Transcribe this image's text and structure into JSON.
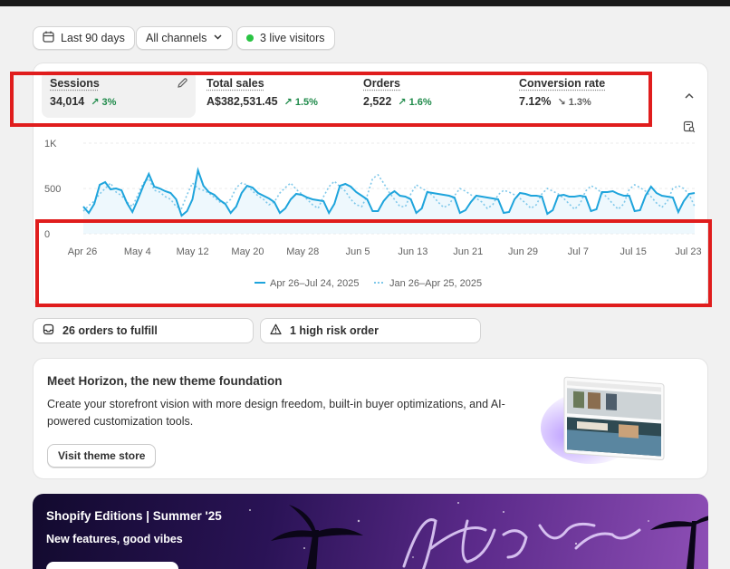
{
  "filters": {
    "date_range": "Last 90 days",
    "channels": "All channels",
    "live_visitors": "3 live visitors",
    "live_color": "#29c443"
  },
  "metrics": [
    {
      "label": "Sessions",
      "value": "34,014",
      "delta": "3%",
      "direction": "up"
    },
    {
      "label": "Total sales",
      "value": "A$382,531.45",
      "delta": "1.5%",
      "direction": "up"
    },
    {
      "label": "Orders",
      "value": "2,522",
      "delta": "1.6%",
      "direction": "up"
    },
    {
      "label": "Conversion rate",
      "value": "7.12%",
      "delta": "1.3%",
      "direction": "down"
    }
  ],
  "metric_icons": {
    "edit": "pencil-icon",
    "collapse": "chevron-up-icon",
    "report": "report-search-icon"
  },
  "chart_data": {
    "type": "line",
    "yticks": [
      "1K",
      "500",
      "0"
    ],
    "ylim": [
      0,
      1000
    ],
    "xticks": [
      "Apr 26",
      "May 4",
      "May 12",
      "May 20",
      "May 28",
      "Jun 5",
      "Jun 13",
      "Jun 21",
      "Jun 29",
      "Jul 7",
      "Jul 15",
      "Jul 23"
    ],
    "series": [
      {
        "name": "Apr 26–Jul 24, 2025",
        "style": "solid",
        "color": "#1ea4dc",
        "values": [
          300,
          230,
          330,
          540,
          570,
          490,
          500,
          480,
          340,
          240,
          380,
          530,
          660,
          520,
          500,
          470,
          450,
          380,
          200,
          250,
          380,
          700,
          530,
          460,
          430,
          370,
          330,
          230,
          300,
          450,
          530,
          510,
          450,
          420,
          390,
          350,
          230,
          280,
          380,
          440,
          430,
          400,
          380,
          370,
          360,
          230,
          330,
          530,
          550,
          520,
          460,
          420,
          380,
          250,
          250,
          360,
          430,
          470,
          420,
          410,
          380,
          230,
          280,
          460,
          450,
          440,
          430,
          420,
          400,
          230,
          260,
          350,
          420,
          410,
          400,
          390,
          380,
          230,
          240,
          380,
          450,
          440,
          420,
          420,
          410,
          220,
          260,
          420,
          430,
          410,
          410,
          420,
          410,
          250,
          270,
          460,
          460,
          470,
          440,
          420,
          420,
          250,
          260,
          420,
          520,
          450,
          420,
          410,
          400,
          240,
          360,
          440,
          450
        ]
      },
      {
        "name": "Jan 26–Apr 25, 2025",
        "style": "dotted",
        "color": "#7fc8ea",
        "values": [
          250,
          310,
          360,
          440,
          500,
          560,
          460,
          420,
          350,
          300,
          430,
          560,
          610,
          480,
          460,
          410,
          380,
          300,
          280,
          430,
          560,
          500,
          480,
          450,
          400,
          350,
          330,
          380,
          510,
          560,
          540,
          470,
          420,
          380,
          320,
          350,
          450,
          510,
          560,
          490,
          440,
          380,
          320,
          280,
          410,
          520,
          580,
          520,
          470,
          380,
          320,
          300,
          420,
          610,
          650,
          560,
          460,
          380,
          300,
          300,
          440,
          540,
          500,
          470,
          420,
          350,
          290,
          320,
          420,
          500,
          470,
          430,
          390,
          350,
          280,
          320,
          430,
          480,
          460,
          430,
          390,
          340,
          280,
          320,
          440,
          500,
          470,
          440,
          390,
          330,
          270,
          330,
          470,
          530,
          500,
          450,
          400,
          330,
          270,
          330,
          490,
          540,
          510,
          470,
          410,
          340,
          290,
          360,
          500,
          530,
          500,
          430,
          300
        ]
      }
    ]
  },
  "fulfillment": {
    "orders_to_fulfill": "26 orders to fulfill",
    "high_risk": "1 high risk order"
  },
  "horizon_promo": {
    "title": "Meet Horizon, the new theme foundation",
    "description": "Create your storefront vision with more design freedom, built-in buyer optimizations, and AI-powered customization tools.",
    "button": "Visit theme store"
  },
  "editions_promo": {
    "title": "Shopify Editions | Summer '25",
    "subtitle": "New features, good vibes"
  }
}
